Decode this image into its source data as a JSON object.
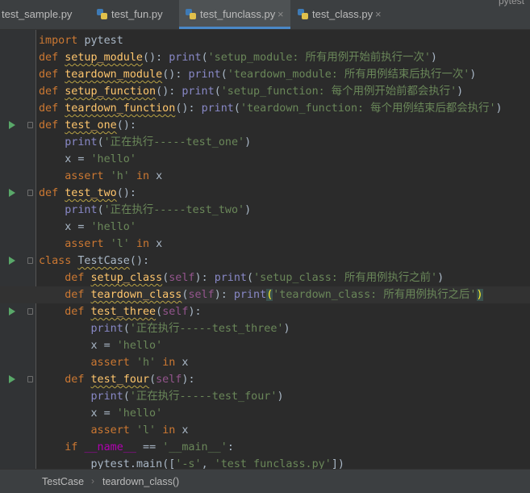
{
  "tabs": [
    {
      "label": "test_sample.py",
      "active": false,
      "icon": "python-file-icon"
    },
    {
      "label": "test_fun.py",
      "active": false,
      "icon": "python-file-icon"
    },
    {
      "label": "test_funclass.py",
      "active": true,
      "icon": "python-file-icon"
    },
    {
      "label": "test_class.py",
      "active": false,
      "icon": "python-file-icon"
    }
  ],
  "tab_close_glyph": "×",
  "overflow_label": "pytest",
  "code": {
    "lines": [
      "import pytest",
      "def setup_module(): print('setup_module: 所有用例开始前执行一次')",
      "def teardown_module(): print('teardown_module: 所有用例结束后执行一次')",
      "def setup_function(): print('setup_function: 每个用例开始前都会执行')",
      "def teardown_function(): print('teardown_function: 每个用例结束后都会执行')",
      "def test_one():",
      "    print('正在执行-----test_one')",
      "    x = 'hello'",
      "    assert 'h' in x",
      "def test_two():",
      "    print('正在执行-----test_two')",
      "    x = 'hello'",
      "    assert 'l' in x",
      "class TestCase():",
      "    def setup_class(self): print('setup_class: 所有用例执行之前')",
      "    def teardown_class(self): print('teardown_class: 所有用例执行之后')",
      "    def test_three(self):",
      "        print('正在执行-----test_three')",
      "        x = 'hello'",
      "        assert 'h' in x",
      "    def test_four(self):",
      "        print('正在执行-----test_four')",
      "        x = 'hello'",
      "        assert 'l' in x",
      "    if __name__ == '__main__':",
      "        pytest.main(['-s', 'test_funclass.py'])"
    ],
    "run_markers_on_lines": [
      6,
      10,
      14,
      17,
      21
    ],
    "current_line": 16
  },
  "breadcrumb": {
    "items": [
      "TestCase",
      "teardown_class()"
    ],
    "separator": "›"
  },
  "colors": {
    "editor_bg": "#2b2b2b",
    "keyword": "#cc7832",
    "function": "#ffc66d",
    "string": "#6a8759",
    "builtin": "#8888c6",
    "self": "#94558d",
    "run_marker": "#59a869",
    "active_tab_underline": "#4a88c7"
  }
}
